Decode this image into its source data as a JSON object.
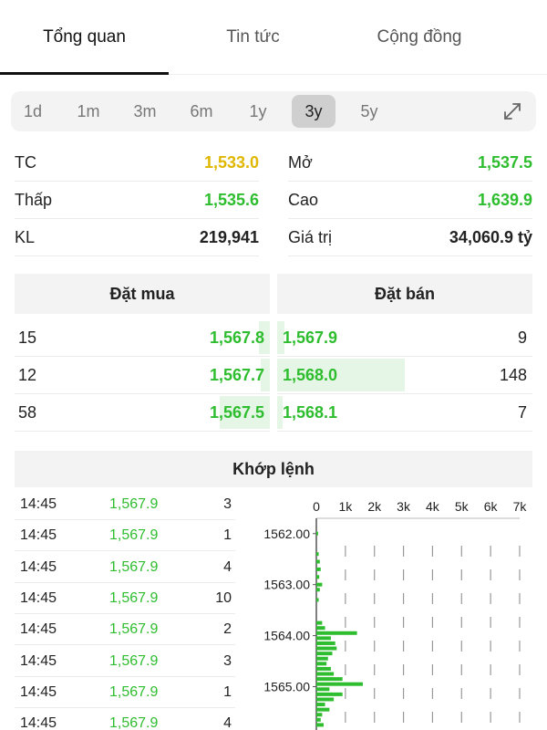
{
  "tabs": [
    {
      "label": "Tổng quan",
      "active": true
    },
    {
      "label": "Tin tức",
      "active": false
    },
    {
      "label": "Cộng đồng",
      "active": false
    }
  ],
  "periods": [
    {
      "label": "1d",
      "active": false
    },
    {
      "label": "1m",
      "active": false
    },
    {
      "label": "3m",
      "active": false
    },
    {
      "label": "6m",
      "active": false
    },
    {
      "label": "1y",
      "active": false
    },
    {
      "label": "3y",
      "active": true
    },
    {
      "label": "5y",
      "active": false
    }
  ],
  "stats": {
    "tc": {
      "label": "TC",
      "value": "1,533.0"
    },
    "mo": {
      "label": "Mở",
      "value": "1,537.5"
    },
    "thap": {
      "label": "Thấp",
      "value": "1,535.6"
    },
    "cao": {
      "label": "Cao",
      "value": "1,639.9"
    },
    "kl": {
      "label": "KL",
      "value": "219,941"
    },
    "giatri": {
      "label": "Giá trị",
      "value": "34,060.9 tỷ"
    }
  },
  "orderbook": {
    "buy_title": "Đặt mua",
    "sell_title": "Đặt bán",
    "rows": [
      {
        "buy_qty": "15",
        "buy_price": "1,567.8",
        "sell_price": "1,567.9",
        "sell_qty": "9"
      },
      {
        "buy_qty": "12",
        "buy_price": "1,567.7",
        "sell_price": "1,568.0",
        "sell_qty": "148"
      },
      {
        "buy_qty": "58",
        "buy_price": "1,567.5",
        "sell_price": "1,568.1",
        "sell_qty": "7"
      }
    ]
  },
  "matched": {
    "title": "Khớp lệnh",
    "trades": [
      {
        "time": "14:45",
        "price": "1,567.9",
        "qty": "3"
      },
      {
        "time": "14:45",
        "price": "1,567.9",
        "qty": "1"
      },
      {
        "time": "14:45",
        "price": "1,567.9",
        "qty": "4"
      },
      {
        "time": "14:45",
        "price": "1,567.9",
        "qty": "10"
      },
      {
        "time": "14:45",
        "price": "1,567.9",
        "qty": "2"
      },
      {
        "time": "14:45",
        "price": "1,567.9",
        "qty": "3"
      },
      {
        "time": "14:45",
        "price": "1,567.9",
        "qty": "1"
      },
      {
        "time": "14:45",
        "price": "1,567.9",
        "qty": "4"
      }
    ]
  },
  "chart_data": {
    "type": "bar",
    "orientation": "horizontal",
    "x_ticks": [
      "0",
      "1k",
      "2k",
      "3k",
      "4k",
      "5k",
      "6k",
      "7k"
    ],
    "xlim": [
      0,
      7000
    ],
    "y_ticks": [
      "1562.00",
      "1563.00",
      "1564.00",
      "1565.00"
    ],
    "ylim": [
      1561.7,
      1565.85
    ],
    "bar_color": "#2ebd2e",
    "bars": [
      {
        "price": 1562.0,
        "volume": 60
      },
      {
        "price": 1562.4,
        "volume": 80
      },
      {
        "price": 1562.55,
        "volume": 120
      },
      {
        "price": 1562.7,
        "volume": 150
      },
      {
        "price": 1562.85,
        "volume": 100
      },
      {
        "price": 1563.0,
        "volume": 200
      },
      {
        "price": 1563.1,
        "volume": 120
      },
      {
        "price": 1563.3,
        "volume": 80
      },
      {
        "price": 1563.75,
        "volume": 200
      },
      {
        "price": 1563.85,
        "volume": 300
      },
      {
        "price": 1563.95,
        "volume": 1400
      },
      {
        "price": 1564.05,
        "volume": 500
      },
      {
        "price": 1564.15,
        "volume": 650
      },
      {
        "price": 1564.25,
        "volume": 700
      },
      {
        "price": 1564.35,
        "volume": 550
      },
      {
        "price": 1564.45,
        "volume": 400
      },
      {
        "price": 1564.55,
        "volume": 350
      },
      {
        "price": 1564.65,
        "volume": 500
      },
      {
        "price": 1564.75,
        "volume": 600
      },
      {
        "price": 1564.85,
        "volume": 900
      },
      {
        "price": 1564.95,
        "volume": 1600
      },
      {
        "price": 1565.05,
        "volume": 450
      },
      {
        "price": 1565.15,
        "volume": 900
      },
      {
        "price": 1565.25,
        "volume": 600
      },
      {
        "price": 1565.35,
        "volume": 300
      },
      {
        "price": 1565.45,
        "volume": 450
      },
      {
        "price": 1565.55,
        "volume": 200
      },
      {
        "price": 1565.65,
        "volume": 150
      },
      {
        "price": 1565.75,
        "volume": 250
      }
    ]
  },
  "colors": {
    "up": "#2ebd2e",
    "reference": "#e0b700",
    "panel": "#f3f3f3"
  },
  "icons": {
    "expand": "expand-icon"
  }
}
